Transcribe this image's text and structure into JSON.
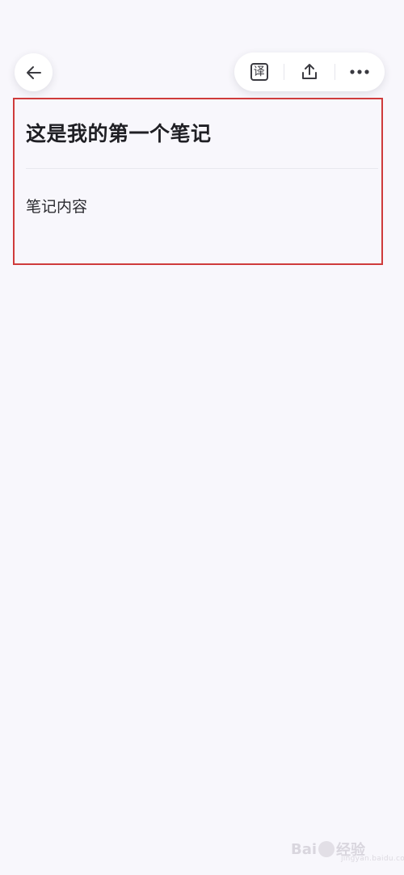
{
  "toolbar": {
    "back_icon": "arrow-left-icon",
    "translate_icon": "translate-icon",
    "translate_glyph": "译",
    "share_icon": "share-icon",
    "more_icon": "more-horizontal-icon"
  },
  "note": {
    "title": "这是我的第一个笔记",
    "body": "笔记内容"
  },
  "watermark": {
    "brand_left": "Bai",
    "brand_right": "经验",
    "url": "jingyan.baidu.com"
  },
  "colors": {
    "background": "#f8f7fc",
    "highlight_border": "#cf3b3b",
    "icon": "#3a3a40"
  }
}
